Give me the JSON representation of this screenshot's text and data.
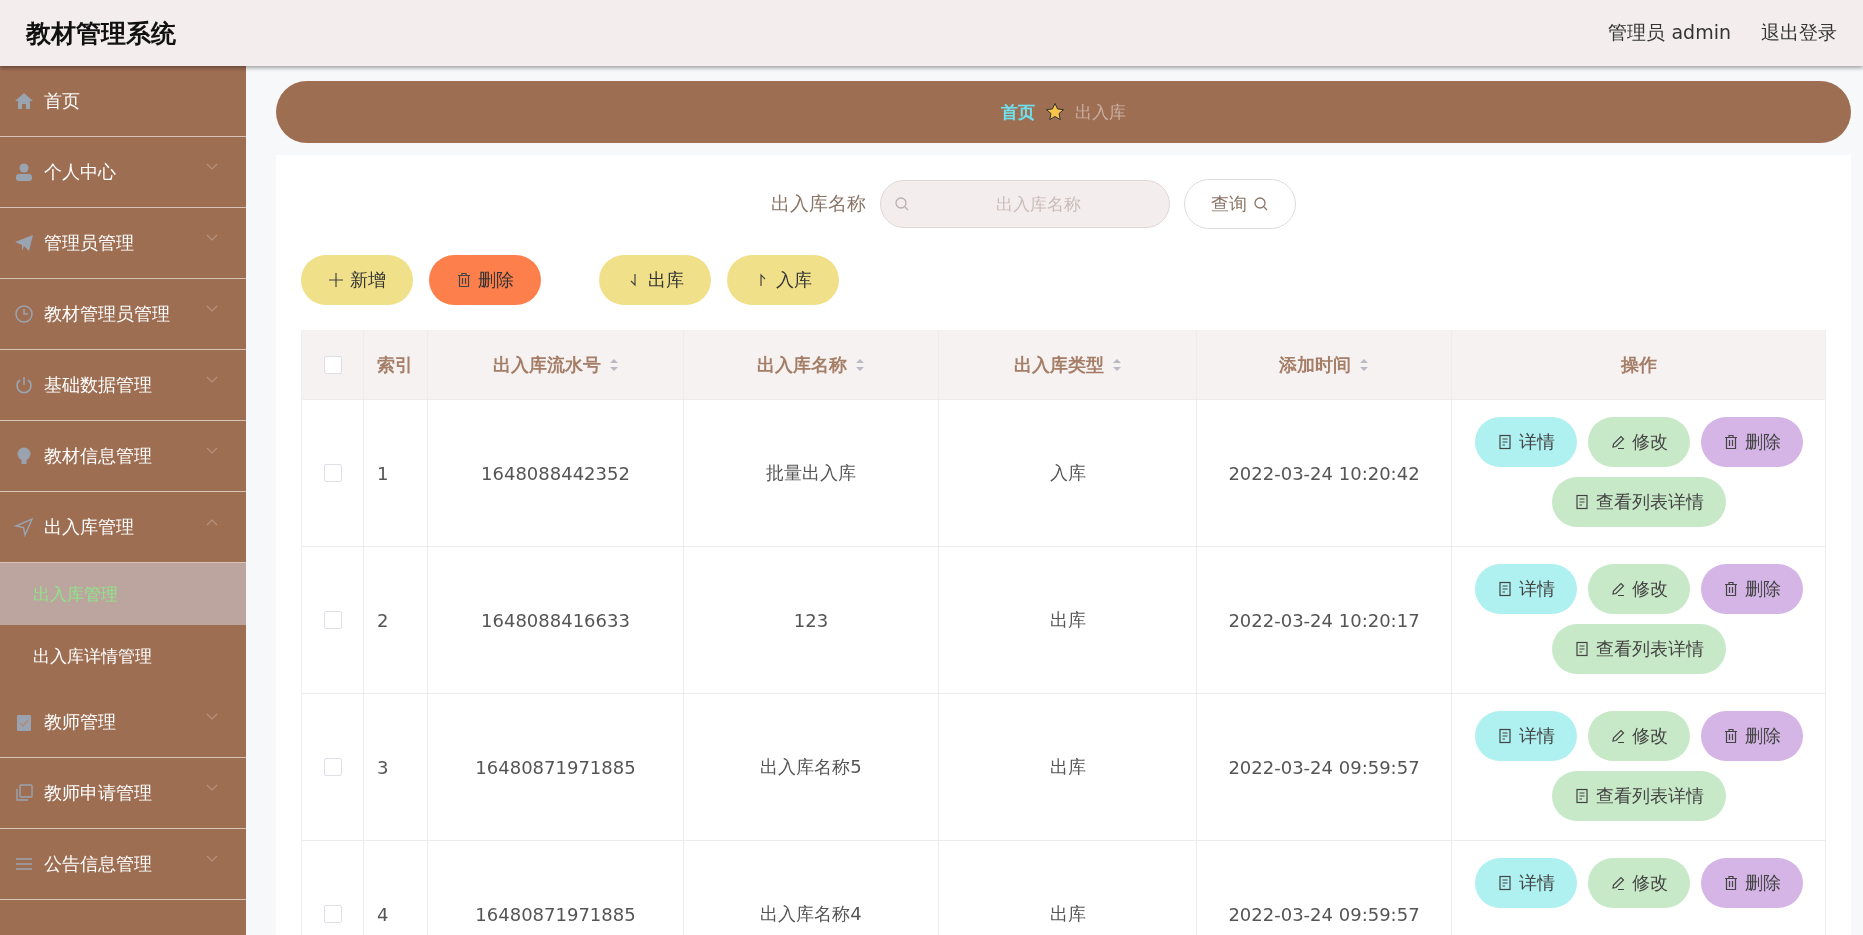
{
  "header": {
    "title": "教材管理系统",
    "user": "管理员 admin",
    "logout": "退出登录"
  },
  "sidebar": {
    "items": [
      {
        "label": "首页"
      },
      {
        "label": "个人中心",
        "expanded": false
      },
      {
        "label": "管理员管理",
        "expanded": false
      },
      {
        "label": "教材管理员管理",
        "expanded": false
      },
      {
        "label": "基础数据管理",
        "expanded": false
      },
      {
        "label": "教材信息管理",
        "expanded": false
      },
      {
        "label": "出入库管理",
        "expanded": true,
        "children": [
          {
            "label": "出入库管理",
            "selected": true
          },
          {
            "label": "出入库详情管理",
            "selected": false
          }
        ]
      },
      {
        "label": "教师管理",
        "expanded": false
      },
      {
        "label": "教师申请管理",
        "expanded": false
      },
      {
        "label": "公告信息管理",
        "expanded": false
      }
    ]
  },
  "breadcrumb": [
    "首页",
    "出入库"
  ],
  "search": {
    "label": "出入库名称",
    "placeholder": "出入库名称",
    "button": "查询"
  },
  "toolbar": [
    {
      "label": "新增",
      "kind": "add"
    },
    {
      "label": "删除",
      "kind": "delete"
    },
    {
      "label": "出库",
      "kind": "out"
    },
    {
      "label": "入库",
      "kind": "in"
    }
  ],
  "table": {
    "header_checked": false,
    "columns": [
      {
        "label": "索引",
        "sortable": false
      },
      {
        "label": "出入库流水号",
        "sortable": true
      },
      {
        "label": "出入库名称",
        "sortable": true
      },
      {
        "label": "出入库类型",
        "sortable": true
      },
      {
        "label": "添加时间",
        "sortable": true
      },
      {
        "label": "操作",
        "sortable": false
      }
    ],
    "rows": [
      {
        "checked": false,
        "cells": [
          "1",
          "1648088442352",
          "批量出入库",
          "入库",
          "2022-03-24 10:20:42"
        ],
        "actions": [
          {
            "label": "详情",
            "kind": "detail"
          },
          {
            "label": "修改",
            "kind": "edit"
          },
          {
            "label": "删除",
            "kind": "delete"
          },
          {
            "label": "查看列表详情",
            "kind": "list"
          }
        ]
      },
      {
        "checked": false,
        "cells": [
          "2",
          "1648088416633",
          "123",
          "出库",
          "2022-03-24 10:20:17"
        ],
        "actions": [
          {
            "label": "详情",
            "kind": "detail"
          },
          {
            "label": "修改",
            "kind": "edit"
          },
          {
            "label": "删除",
            "kind": "delete"
          },
          {
            "label": "查看列表详情",
            "kind": "list"
          }
        ]
      },
      {
        "checked": false,
        "cells": [
          "3",
          "16480871971885",
          "出入库名称5",
          "出库",
          "2022-03-24 09:59:57"
        ],
        "actions": [
          {
            "label": "详情",
            "kind": "detail"
          },
          {
            "label": "修改",
            "kind": "edit"
          },
          {
            "label": "删除",
            "kind": "delete"
          },
          {
            "label": "查看列表详情",
            "kind": "list"
          }
        ]
      },
      {
        "checked": false,
        "cells": [
          "4",
          "16480871971885",
          "出入库名称4",
          "出库",
          "2022-03-24 09:59:57"
        ],
        "actions": [
          {
            "label": "详情",
            "kind": "detail"
          },
          {
            "label": "修改",
            "kind": "edit"
          },
          {
            "label": "删除",
            "kind": "delete"
          }
        ]
      }
    ]
  }
}
